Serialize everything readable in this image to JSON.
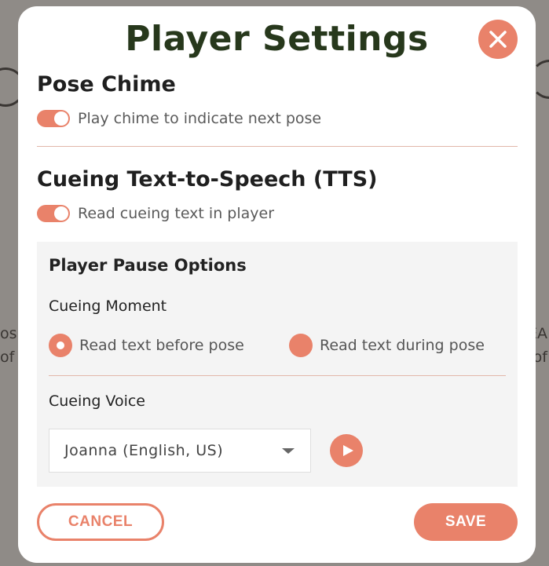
{
  "background": {
    "fragments_left": [
      "os",
      "of"
    ],
    "fragments_right": [
      "EA",
      "of"
    ]
  },
  "modal": {
    "title": "Player Settings",
    "close_icon": "close-icon"
  },
  "pose_chime": {
    "title": "Pose Chime",
    "toggle_on": true,
    "toggle_label": "Play chime to indicate next pose"
  },
  "tts": {
    "title": "Cueing Text-to-Speech (TTS)",
    "toggle_on": true,
    "toggle_label": "Read cueing text in player"
  },
  "pause_options": {
    "title": "Player Pause Options",
    "cueing_moment_label": "Cueing Moment",
    "options": [
      {
        "label": "Read text before pose",
        "selected": true
      },
      {
        "label": "Read text during pose",
        "selected": false
      }
    ],
    "cueing_voice_label": "Cueing Voice",
    "voice_selected": "Joanna (English, US)",
    "play_icon": "play-icon"
  },
  "actions": {
    "cancel_label": "CANCEL",
    "save_label": "SAVE"
  },
  "colors": {
    "accent": "#e9826a",
    "title": "#27381c",
    "overlay": "#8f8b87",
    "panel": "#f4f4f4"
  }
}
